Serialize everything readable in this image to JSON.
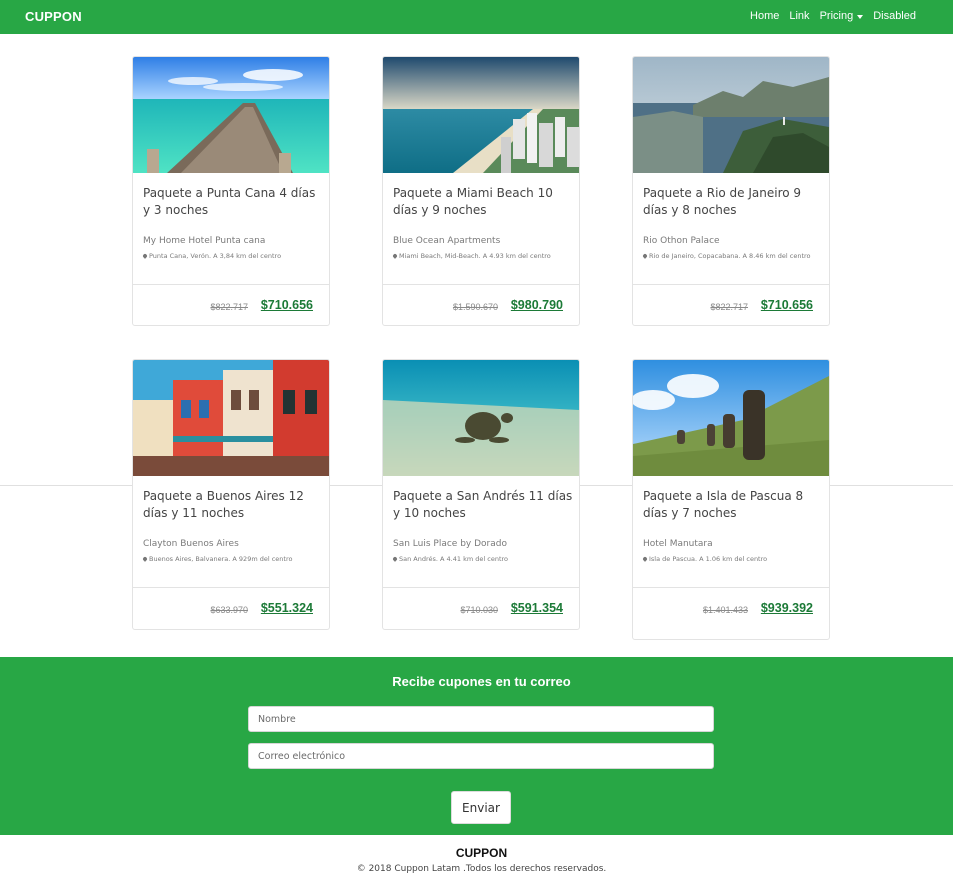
{
  "navbar": {
    "brand": "CUPPON",
    "links": [
      {
        "label": "Home"
      },
      {
        "label": "Link"
      },
      {
        "label": "Pricing"
      },
      {
        "label": "Disabled"
      }
    ]
  },
  "cards": [
    {
      "title": "Paquete a Punta Cana 4 días y 3 noches",
      "hotel": "My Home Hotel Punta cana",
      "location": "Punta Cana, Verón. A 3,84 km del centro",
      "old_price": "$822.717",
      "new_price": "$710.656",
      "image": "beach-pier-photo"
    },
    {
      "title": "Paquete a Miami Beach 10 días y 9 noches",
      "hotel": "Blue Ocean Apartments",
      "location": "Miami Beach, Mid-Beach. A 4.93 km del centro",
      "old_price": "$1.590.670",
      "new_price": "$980.790",
      "image": "miami-coast-photo"
    },
    {
      "title": "Paquete a Rio de Janeiro 9 días y 8 noches",
      "hotel": "Rio Othon Palace",
      "location": "Rio de Janeiro, Copacabana. A 8.46 km del centro",
      "old_price": "$822.717",
      "new_price": "$710.656",
      "image": "rio-bay-photo"
    },
    {
      "title": "Paquete a Buenos Aires 12 días y 11 noches",
      "hotel": "Clayton Buenos Aires",
      "location": "Buenos Aires, Balvanera. A 929m del centro",
      "old_price": "$633.970",
      "new_price": "$551.324",
      "image": "caminito-houses-photo"
    },
    {
      "title": "Paquete a San Andrés 11 días y 10 noches",
      "hotel": "San Luis Place by Dorado",
      "location": "San Andrés. A 4.41 km del centro",
      "old_price": "$710.030",
      "new_price": "$591.354",
      "image": "sea-turtle-photo"
    },
    {
      "title": "Paquete a Isla de Pascua 8 días y 7 noches",
      "hotel": "Hotel Manutara",
      "location": "Isla de Pascua. A 1.06 km del centro",
      "old_price": "$1.401.433",
      "new_price": "$939.392",
      "image": "moai-statues-photo"
    }
  ],
  "newsletter": {
    "title": "Recibe cupones en tu correo",
    "name_placeholder": "Nombre",
    "email_placeholder": "Correo electrónico",
    "submit_label": "Enviar"
  },
  "footer": {
    "brand": "CUPPON",
    "copyright": "© 2018 Cuppon Latam .Todos los derechos reservados."
  },
  "colors": {
    "brand_green": "#28a745",
    "price_green": "#1c7a37"
  }
}
